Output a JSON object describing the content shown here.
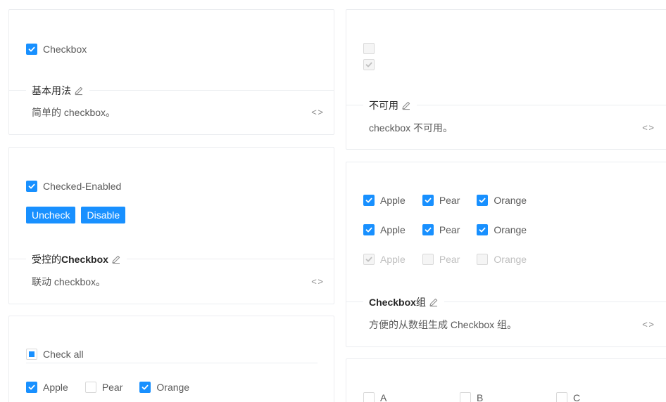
{
  "basic": {
    "checkbox_label": "Checkbox",
    "title": "基本用法",
    "desc": "简单的 checkbox。"
  },
  "disabled": {
    "title": "不可用",
    "desc": "checkbox 不可用。"
  },
  "controlled": {
    "checkbox_label": "Checked-Enabled",
    "uncheck_button": "Uncheck",
    "disable_button": "Disable",
    "title_cn": "受控的 ",
    "title_en": "Checkbox",
    "desc": "联动 checkbox。"
  },
  "group": {
    "rows": [
      [
        "Apple",
        "Pear",
        "Orange"
      ],
      [
        "Apple",
        "Pear",
        "Orange"
      ],
      [
        "Apple",
        "Pear",
        "Orange"
      ]
    ],
    "title_en": "Checkbox",
    "title_cn": " 组",
    "desc": "方便的从数组生成 Checkbox 组。"
  },
  "check_all": {
    "label": "Check all",
    "options": [
      "Apple",
      "Pear",
      "Orange"
    ]
  },
  "layout": {
    "options": [
      "A",
      "B",
      "C"
    ]
  },
  "icons": {
    "code": "< >"
  },
  "colors": {
    "primary": "#1890ff",
    "border": "#ebedf0"
  }
}
